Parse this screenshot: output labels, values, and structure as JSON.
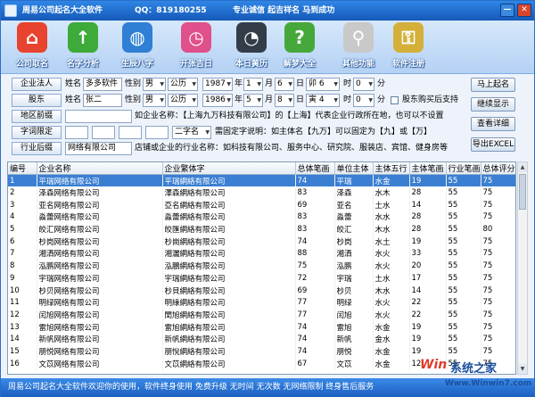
{
  "app": {
    "title": "周易公司起名大全软件",
    "qq": "QQ：819180255",
    "slogan": "专业诚信 起吉祥名 马到成功",
    "min_label": "—",
    "close_label": "✕"
  },
  "toolbar": [
    {
      "label": "公司取名",
      "icon": "house-icon",
      "color": "#e8432f",
      "glyph": "⌂"
    },
    {
      "label": "名字分析",
      "icon": "up-arrow-icon",
      "color": "#3daa3a",
      "glyph": "↑"
    },
    {
      "label": "生辰八字",
      "icon": "globe-icon",
      "color": "#2f7fd4",
      "glyph": "◍"
    },
    {
      "label": "开张吉日",
      "icon": "clock-icon",
      "color": "#e0508a",
      "glyph": "◷"
    },
    {
      "label": "本日黄历",
      "icon": "alarm-clock-icon",
      "color": "#333d4a",
      "glyph": "◔"
    },
    {
      "label": "解梦大全",
      "icon": "question-icon",
      "color": "#46a83b",
      "glyph": "?"
    },
    {
      "label": "其他功能",
      "icon": "magnifier-icon",
      "color": "#c9c9c9",
      "glyph": "⚲"
    },
    {
      "label": "软件注册",
      "icon": "keys-icon",
      "color": "#d4b03a",
      "glyph": "⚿"
    }
  ],
  "form": {
    "legal_label": "企业法人",
    "name_label": "姓名",
    "name_value": "多多软件",
    "gender_label": "性别",
    "gender_value": "男",
    "calendar_value": "公历",
    "year_value": "1987",
    "year_unit": "年",
    "month_value": "1",
    "month_unit": "月",
    "day_value": "6",
    "day_unit": "日",
    "ganzhi_value": "卯 6",
    "hour_value": "0",
    "hour_unit": "时",
    "minute_value": "0",
    "minute_unit": "分",
    "shareholder_label": "股东",
    "name2_value": "张二",
    "gender2_value": "男",
    "calendar2_value": "公历",
    "year2_value": "1986",
    "month2_value": "5",
    "day2_value": "8",
    "ganzhi2_value": "寅 4",
    "hour2_value": "0",
    "minute2_value": "0",
    "checkbox_label": "股东购买后支持",
    "region_label": "地区前缀",
    "region_hint": "如企业名称：【上海九万科技有限公司】的【上海】代表企业行政所在地，也可以不设置",
    "fixed_label": "字词限定",
    "fixed_select": "二字名",
    "fixed_hint": "需固定字说明：如主体名【九万】可以固定为【九】或【万】",
    "industry_label": "行业后缀",
    "industry_value": "网络有限公司",
    "industry_hint": "店铺或企业的行业名称：如科技有限公司、服务中心、研究院、服装店、宾馆、健身房等"
  },
  "buttons": {
    "start": "马上起名",
    "continue": "继续显示",
    "detail": "查看详细",
    "export": "导出EXCEL"
  },
  "table": {
    "columns": [
      "编号",
      "企业名称",
      "企业繁体字",
      "总体笔画",
      "单位主体",
      "主体五行",
      "主体笔画",
      "行业笔画",
      "总体评分"
    ],
    "rows": [
      [
        "1",
        "平瑞网络有限公司",
        "平瑞網絡有限公司",
        "74",
        "平瑞",
        "水金",
        "19",
        "55",
        "75"
      ],
      [
        "2",
        "泽森网络有限公司",
        "澤森網絡有限公司",
        "83",
        "泽森",
        "水木",
        "28",
        "55",
        "75"
      ],
      [
        "3",
        "亚名网络有限公司",
        "亞名網絡有限公司",
        "69",
        "亚名",
        "土水",
        "14",
        "55",
        "75"
      ],
      [
        "4",
        "淼蕾网络有限公司",
        "淼蕾網絡有限公司",
        "83",
        "淼蕾",
        "水水",
        "28",
        "55",
        "75"
      ],
      [
        "5",
        "皎汇网络有限公司",
        "皎匯網絡有限公司",
        "83",
        "皎汇",
        "木水",
        "28",
        "55",
        "80"
      ],
      [
        "6",
        "杪岗网络有限公司",
        "杪崗網絡有限公司",
        "74",
        "杪岗",
        "水土",
        "19",
        "55",
        "75"
      ],
      [
        "7",
        "湘洒网络有限公司",
        "湘灑網絡有限公司",
        "88",
        "湘洒",
        "水火",
        "33",
        "55",
        "75"
      ],
      [
        "8",
        "泓鹏网络有限公司",
        "泓鵬網絡有限公司",
        "75",
        "泓鹏",
        "水火",
        "20",
        "55",
        "75"
      ],
      [
        "9",
        "宇瑞网络有限公司",
        "宇瑞網絡有限公司",
        "72",
        "宇瑞",
        "土水",
        "17",
        "55",
        "75"
      ],
      [
        "10",
        "杪贝网络有限公司",
        "杪貝網絡有限公司",
        "69",
        "杪贝",
        "木水",
        "14",
        "55",
        "75"
      ],
      [
        "11",
        "明绿网络有限公司",
        "明綠網絡有限公司",
        "77",
        "明绿",
        "水火",
        "22",
        "55",
        "75"
      ],
      [
        "12",
        "闰旭网络有限公司",
        "閏旭網絡有限公司",
        "77",
        "闰旭",
        "水火",
        "22",
        "55",
        "75"
      ],
      [
        "13",
        "雷旭网络有限公司",
        "雷旭網絡有限公司",
        "74",
        "雷旭",
        "水金",
        "19",
        "55",
        "75"
      ],
      [
        "14",
        "新帆网络有限公司",
        "新帆網絡有限公司",
        "74",
        "新帆",
        "金水",
        "19",
        "55",
        "75"
      ],
      [
        "15",
        "朋悦网络有限公司",
        "朋悅網絡有限公司",
        "74",
        "朋悦",
        "水金",
        "19",
        "55",
        "75"
      ],
      [
        "16",
        "文苡网络有限公司",
        "文苡網絡有限公司",
        "67",
        "文苡",
        "水金",
        "12",
        "55",
        "75"
      ]
    ]
  },
  "status": {
    "text": "周易公司起名大全软件欢迎你的使用，软件终身使用  免费升级  无时间  无次数  无网络限制  终身售后服务"
  },
  "watermark": {
    "logo": "Win",
    "brand": "系统之家",
    "url": "Www.Winwin7.com"
  }
}
